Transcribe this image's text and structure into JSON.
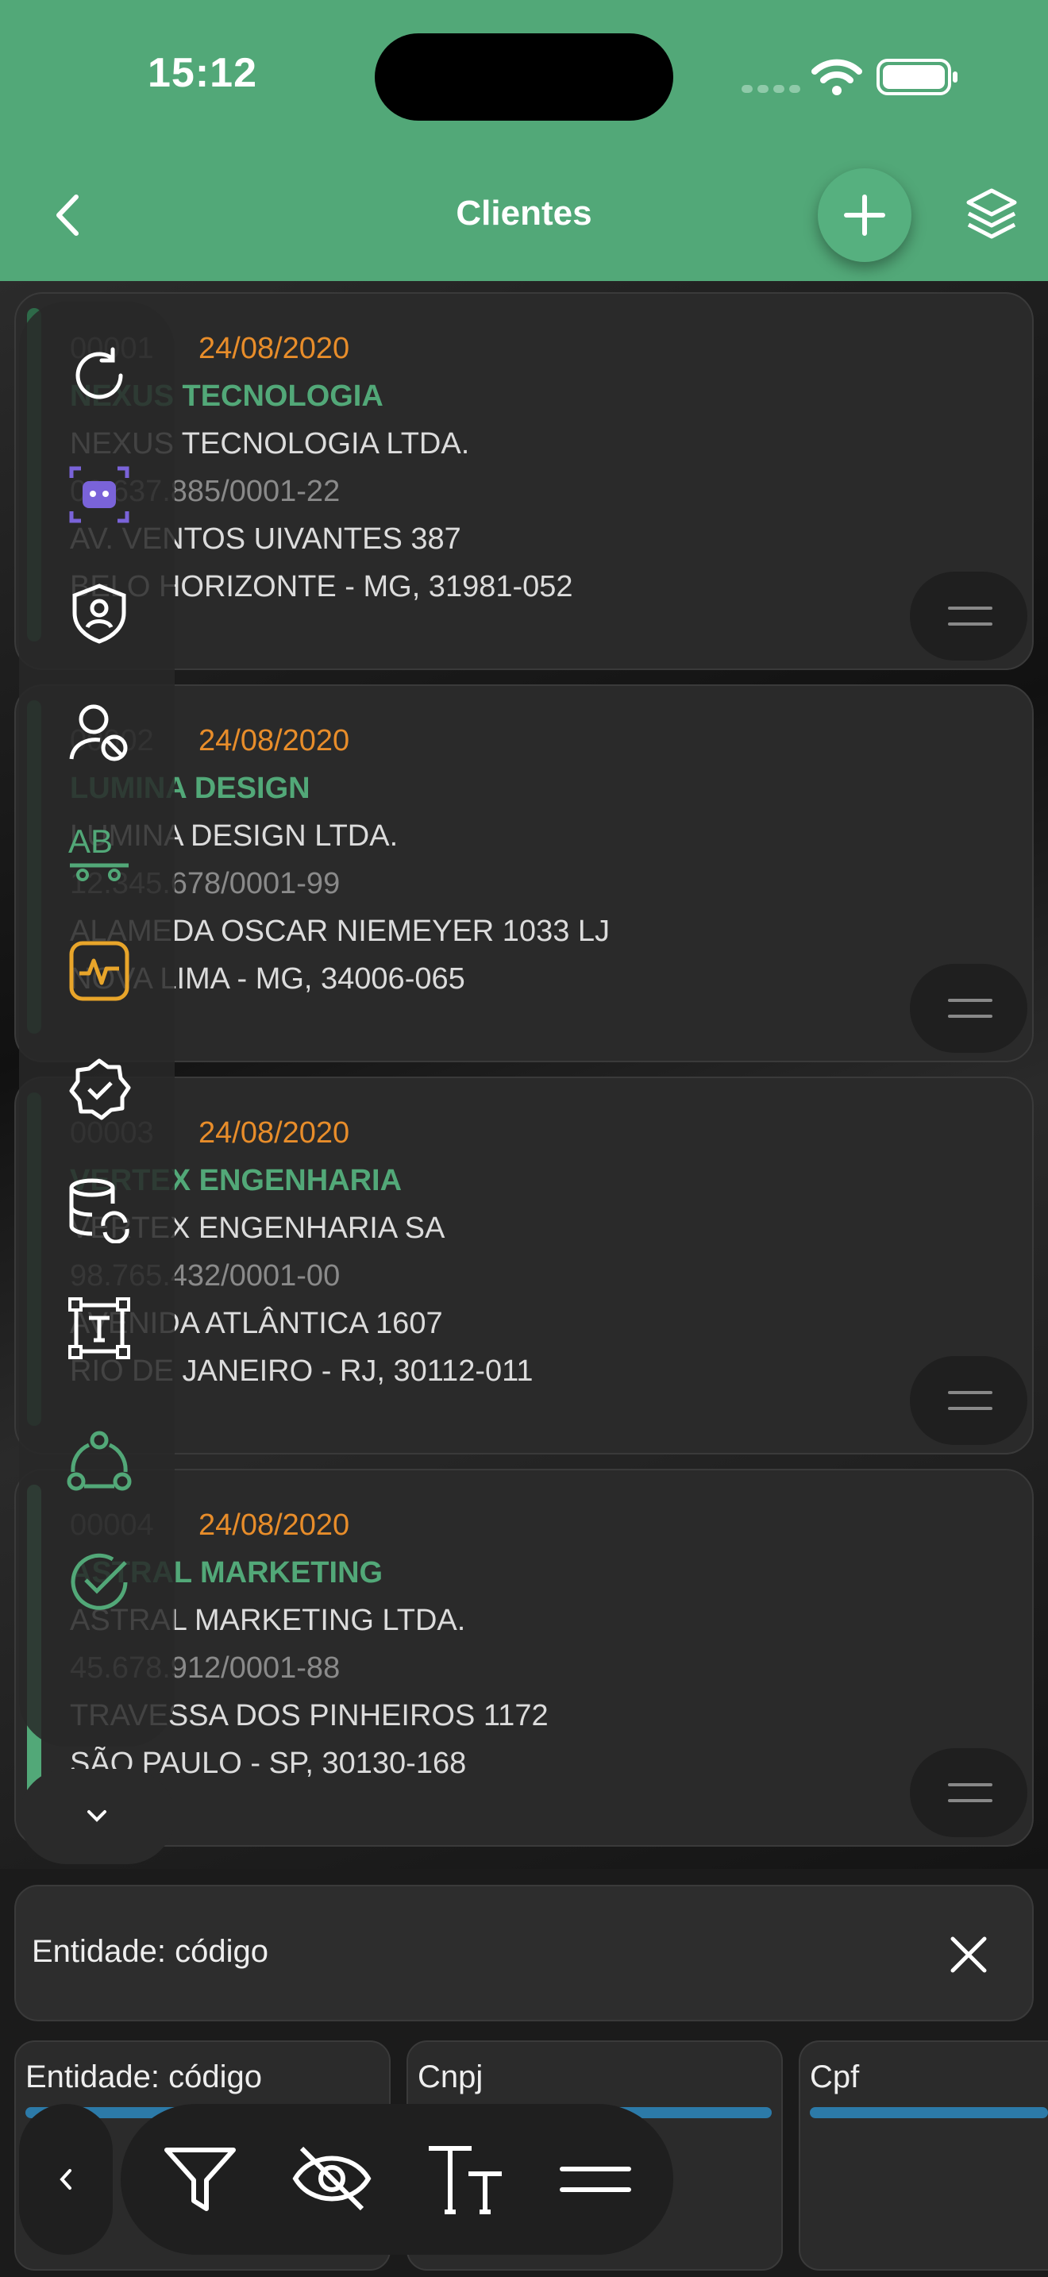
{
  "status_bar": {
    "time": "15:12"
  },
  "header": {
    "title": "Clientes"
  },
  "icons": {
    "back": "chevron-left-icon",
    "add": "plus-icon",
    "layers": "layers-icon",
    "toolbar": [
      "refresh-icon",
      "ai-bot-icon",
      "shield-user-icon",
      "user-block-icon",
      "spellcheck-icon",
      "activity-icon",
      "badge-check-icon",
      "database-sync-icon",
      "text-frame-icon",
      "network-icon",
      "check-circle-icon"
    ],
    "bottom": [
      "filter-icon",
      "eye-off-icon",
      "text-size-icon",
      "menu-icon"
    ]
  },
  "colors": {
    "header": "#52a878",
    "accent_green": "#52a878",
    "date_orange": "#e88d2a",
    "column_bar": "#2c7aa8"
  },
  "clients": [
    {
      "code": "00001",
      "date": "24/08/2020",
      "name": "NEXUS TECNOLOGIA",
      "company": "NEXUS TECNOLOGIA LTDA.",
      "cnpj": "03.637.885/0001-22",
      "address": "AV. VENTOS UIVANTES 387",
      "city": "BELO HORIZONTE - MG, 31981-052"
    },
    {
      "code": "00002",
      "date": "24/08/2020",
      "name": "LUMINA DESIGN",
      "company": "LUMINA DESIGN LTDA.",
      "cnpj": "12.345.678/0001-99",
      "address": "ALAMEDA OSCAR NIEMEYER 1033 LJ",
      "city": "NOVA LIMA - MG, 34006-065"
    },
    {
      "code": "00003",
      "date": "24/08/2020",
      "name": "VERTEX ENGENHARIA",
      "company": "VERTEX ENGENHARIA SA",
      "cnpj": "98.765.432/0001-00",
      "address": "AVENIDA ATLÂNTICA 1607",
      "city": "RIO DE JANEIRO - RJ, 30112-011"
    },
    {
      "code": "00004",
      "date": "24/08/2020",
      "name": "ASTRAL MARKETING",
      "company": "ASTRAL MARKETING LTDA.",
      "cnpj": "45.678.912/0001-88",
      "address": "TRAVESSA DOS PINHEIROS 1172",
      "city": "SÃO PAULO - SP, 30130-168"
    }
  ],
  "filter": {
    "text": "Entidade: código"
  },
  "columns": [
    {
      "label": "Entidade: código"
    },
    {
      "label": "Cnpj"
    },
    {
      "label": "Cpf"
    }
  ]
}
